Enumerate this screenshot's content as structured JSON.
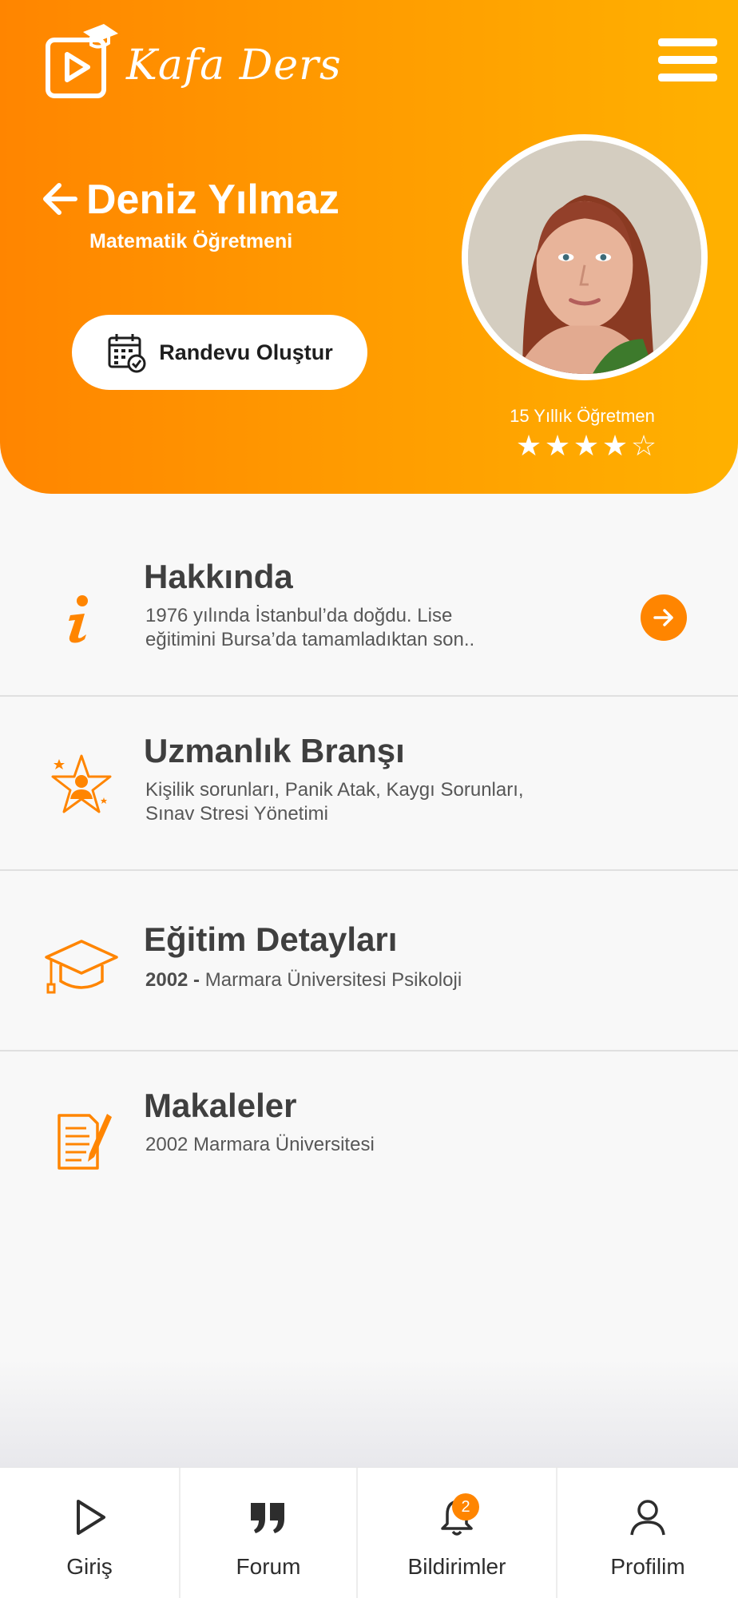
{
  "app": {
    "logo_text": "Kafa Ders"
  },
  "teacher": {
    "name": "Deniz Yılmaz",
    "title": "Matematik Öğretmeni",
    "experience": "15 Yıllık Öğretmen",
    "rating": 4,
    "rating_max": 5
  },
  "actions": {
    "appointment_label": "Randevu Oluştur"
  },
  "sections": {
    "about": {
      "title": "Hakkında",
      "text_line1": "1976 yılında İstanbul’da doğdu. Lise",
      "text_line2": "eğitimini Bursa’da tamamladıktan son.."
    },
    "expertise": {
      "title": "Uzmanlık Branşı",
      "text_line1": "Kişilik sorunları, Panik Atak, Kaygı Sorunları,",
      "text_line2": "Sınav Stresi Yönetimi"
    },
    "education": {
      "title": "Eğitim Detayları",
      "year": "2002 -",
      "detail": "Marmara Üniversitesi  Psikoloji"
    },
    "articles": {
      "title": "Makaleler",
      "text": "2002  Marmara Üniversitesi"
    }
  },
  "bottom_nav": {
    "items": [
      {
        "label": "Giriş",
        "icon": "play-icon"
      },
      {
        "label": "Forum",
        "icon": "quote-icon"
      },
      {
        "label": "Bildirimler",
        "icon": "bell-icon",
        "badge": "2"
      },
      {
        "label": "Profilim",
        "icon": "user-icon"
      }
    ]
  },
  "colors": {
    "accent": "#ff8500",
    "header_gradient_start": "#ff8500",
    "header_gradient_end": "#ffb100",
    "text_dark": "#3f3f3f"
  }
}
